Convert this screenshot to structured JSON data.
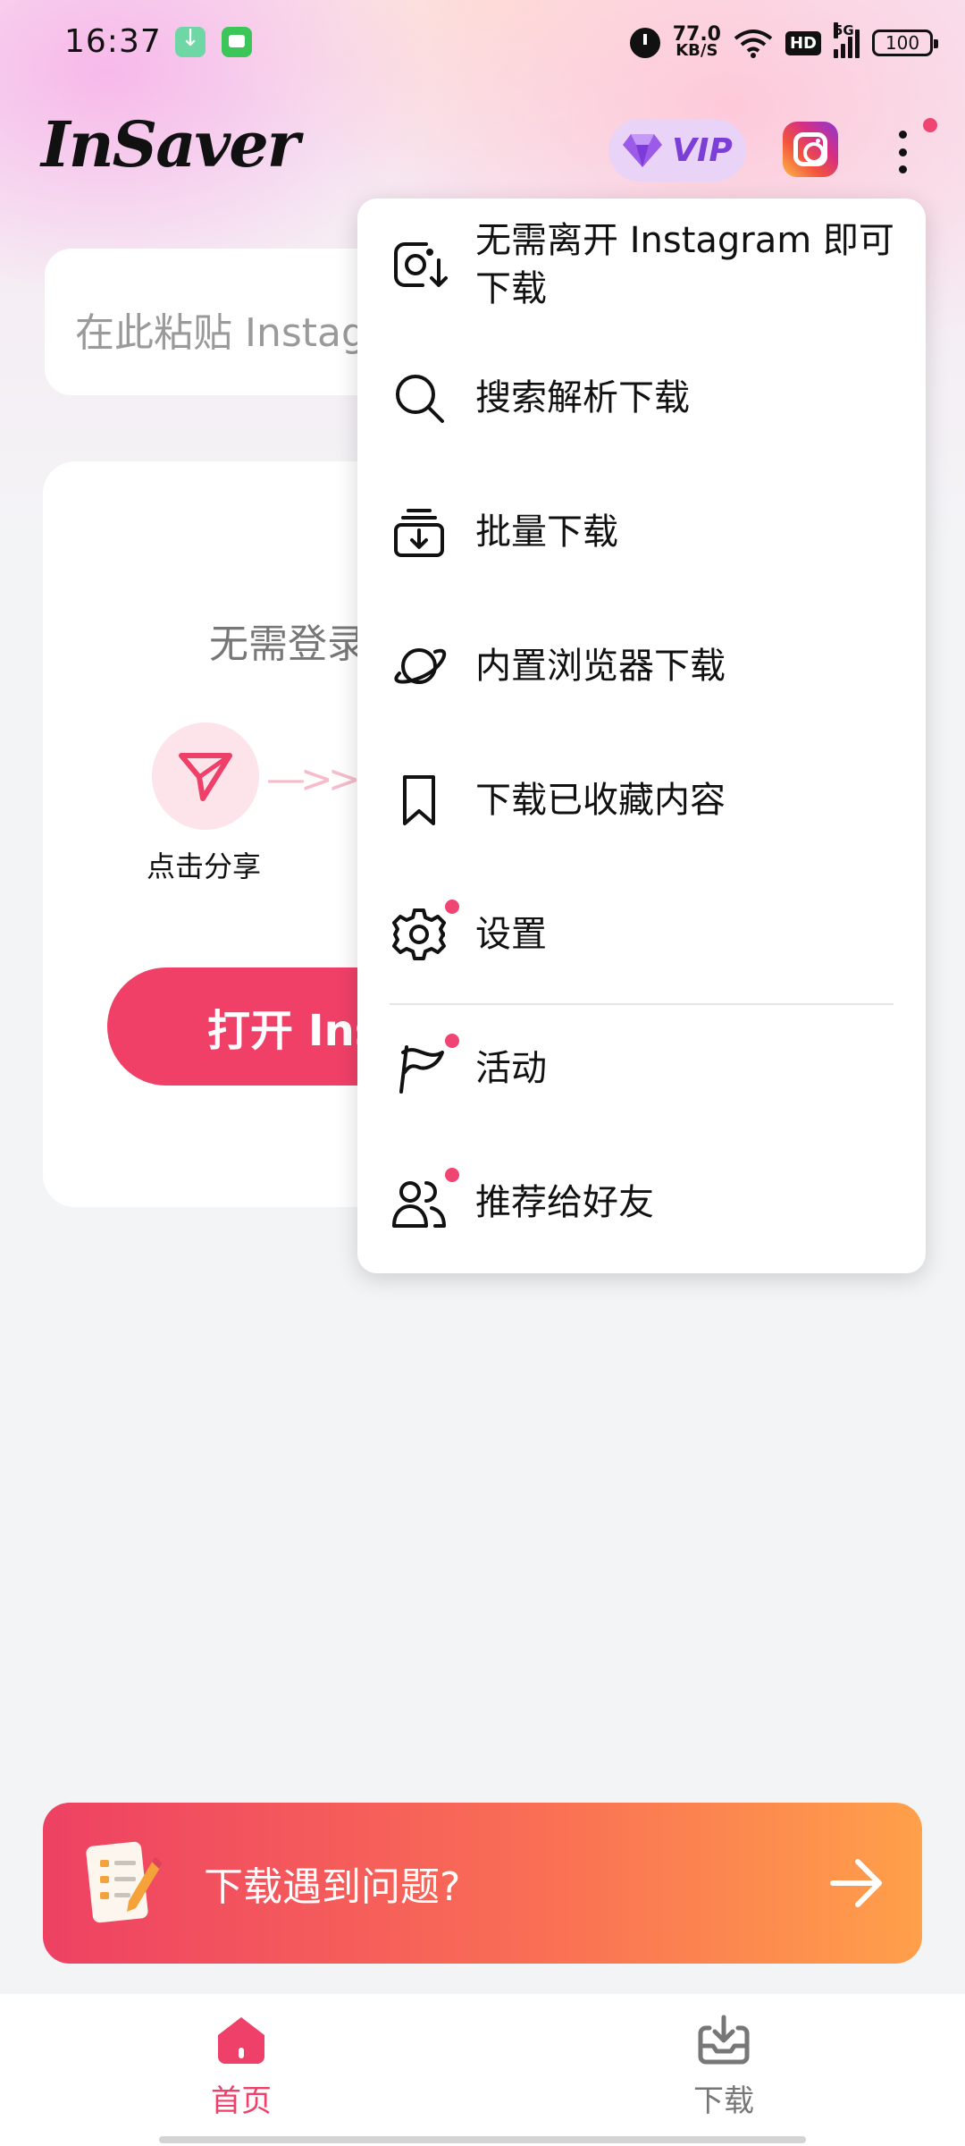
{
  "status_bar": {
    "time": "16:37",
    "net_speed": "77.0",
    "net_unit": "KB/S",
    "hd": "HD",
    "signal": "5G",
    "battery": "100"
  },
  "header": {
    "logo": "InSaver",
    "vip_label": "VIP"
  },
  "paste": {
    "placeholder": "在此粘贴 Instag"
  },
  "guide": {
    "title": "无需登录",
    "step1_label": "点击分享",
    "open_button": "打开 Ins"
  },
  "menu": {
    "items": [
      {
        "label": "无需离开 Instagram 即可下载",
        "icon": "instagram-download-icon"
      },
      {
        "label": "搜索解析下载",
        "icon": "search-icon"
      },
      {
        "label": "批量下载",
        "icon": "batch-download-icon"
      },
      {
        "label": "内置浏览器下载",
        "icon": "planet-icon"
      },
      {
        "label": "下载已收藏内容",
        "icon": "bookmark-icon"
      },
      {
        "label": "设置",
        "icon": "gear-icon"
      },
      {
        "label": "活动",
        "icon": "flag-icon"
      },
      {
        "label": "推荐给好友",
        "icon": "users-icon"
      }
    ]
  },
  "help_banner": {
    "text": "下载遇到问题?"
  },
  "bottom_nav": {
    "home": "首页",
    "download": "下载"
  },
  "colors": {
    "accent": "#f04068",
    "vip": "#7b3fd7",
    "badge_dot": "#f04572"
  }
}
